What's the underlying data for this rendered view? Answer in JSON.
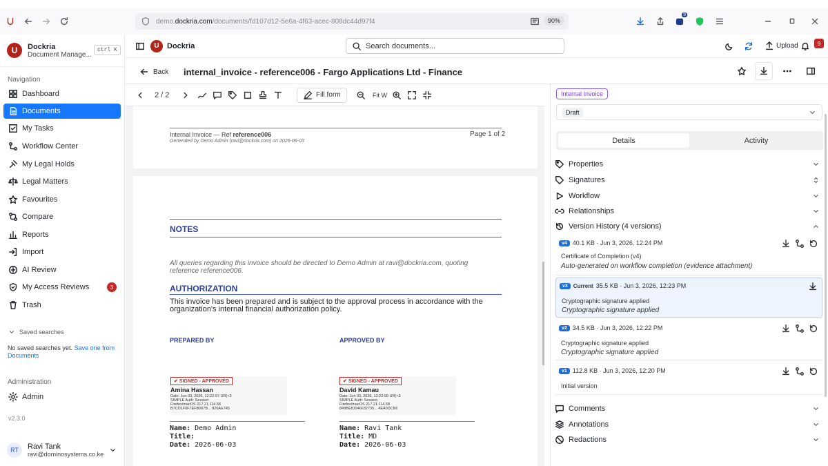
{
  "browser": {
    "url_prefix": "demo.",
    "url_domain": "dockria.com",
    "url_path": "/documents/fd107d12-5e6a-4f63-acec-808dc44d97f4",
    "zoom": "90%",
    "ext_badge": "9"
  },
  "sidebar": {
    "brand_title": "Dockria",
    "brand_sub": "Document Manage...",
    "shortcut": "ctrl K",
    "nav_heading": "Navigation",
    "items": [
      "Dashboard",
      "Documents",
      "My Tasks",
      "Workflow Center",
      "My Legal Holds",
      "Legal Matters",
      "Favourites",
      "Compare",
      "Reports",
      "Import",
      "AI Review",
      "My Access Reviews",
      "Trash"
    ],
    "access_badge": "3",
    "saved_heading": "Saved searches",
    "saved_text": "No saved searches yet.",
    "saved_link": "Save one from Documents",
    "admin_heading": "Administration",
    "admin_item": "Admin",
    "version": "v2.3.0",
    "user_initials": "RT",
    "user_name": "Ravi Tank",
    "user_email": "ravi@dominosystems.co.ke"
  },
  "topbar": {
    "app_name": "Dockria",
    "search_placeholder": "Search documents...",
    "upload": "Upload",
    "notif_count": "9"
  },
  "doc": {
    "back": "Back",
    "title": "internal_invoice - reference006 - Fargo Applications Ltd - Finance"
  },
  "toolbar": {
    "page": "2 / 2",
    "fill_form": "Fill form",
    "fit": "Fit W"
  },
  "page1": {
    "hdr_left": "Internal Invoice — Ref ",
    "hdr_ref": "reference006",
    "hdr_right": "Page 1 of 2",
    "generated": "Generated by Demo Admin (ravi@dockria.com) on 2026-06-03"
  },
  "page2": {
    "notes_h": "NOTES",
    "notes_text": "All queries regarding this invoice should be directed to Demo Admin at ravi@dockria.com, quoting reference reference006.",
    "auth_h": "AUTHORIZATION",
    "auth_text": "This invoice has been prepared and is subject to the approval process in accordance with the organization's internal financial authorization policy.",
    "prepared_h": "PREPARED BY",
    "approved_h": "APPROVED BY",
    "stamp_label": "SIGNED - APPROVED",
    "sig1": {
      "name": "Amina Hassan",
      "d1": "Date: Jun 03, 2026, 12:22:97 UR(+3",
      "d2": "SIMPLE   Auth: Session",
      "d3": "Firefox/macOS   217.21.114.58",
      "d4": "B7CD1F0F7EFB067B...  826AE745"
    },
    "sig2": {
      "name": "David Kamau",
      "d1": "Date: Jun 03, 2026, 12:22:09 UR(+3",
      "d2": "SIMPLE   Auth: Session",
      "d3": "Firefox/macOS   217.21.114.58",
      "d4": "849BE81946632735...  4EA0DCB6"
    },
    "meta_name_lbl": "Name:",
    "meta_title_lbl": "Title:",
    "meta_date_lbl": "Date:",
    "left_name": "Demo Admin",
    "left_title": "",
    "left_date": "2026-06-03",
    "right_name": "Ravi Tank",
    "right_title": "MD",
    "right_date": "2026-06-03"
  },
  "panel": {
    "doc_type": "Internal Invoice",
    "status": "Draft",
    "tab_details": "Details",
    "tab_activity": "Activity",
    "sections": [
      "Properties",
      "Signatures",
      "Workflow",
      "Relationships"
    ],
    "version_history": "Version History (4 versions)",
    "versions": [
      {
        "tag": "v4",
        "current": "",
        "meta": "40.1 KB · Jun 3, 2026, 12:24 PM",
        "l1": "Certificate of Completion (v4)",
        "l2": "Auto-generated on workflow completion (evidence attachment)"
      },
      {
        "tag": "v3",
        "current": "Current",
        "meta": "35.5 KB · Jun 3, 2026, 12:23 PM",
        "l1": "Cryptographic signature applied",
        "l2": "Cryptographic signature applied"
      },
      {
        "tag": "v2",
        "current": "",
        "meta": "34.5 KB · Jun 3, 2026, 12:22 PM",
        "l1": "Cryptographic signature applied",
        "l2": "Cryptographic signature applied"
      },
      {
        "tag": "v1",
        "current": "",
        "meta": "112.8 KB · Jun 3, 2026, 12:20 PM",
        "l1": "Initial version",
        "l2": ""
      }
    ],
    "lower_sections": [
      "Comments",
      "Annotations",
      "Redactions"
    ]
  },
  "colors": {
    "accent": "#1677ff",
    "brand": "#b42318",
    "heading_blue": "#2a3f9d"
  }
}
